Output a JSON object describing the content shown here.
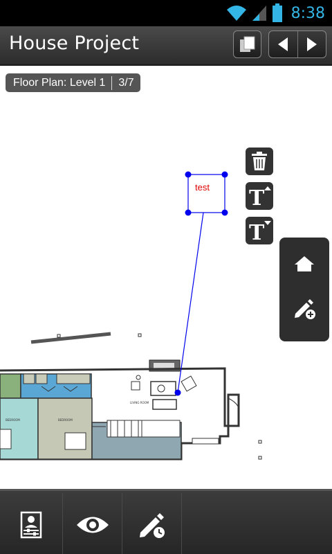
{
  "status_bar": {
    "time": "8:38",
    "icons": [
      "wifi-icon",
      "signal-icon",
      "battery-icon"
    ],
    "accent_color": "#33b5e5"
  },
  "action_bar": {
    "title": "House Project",
    "buttons": [
      "pages-icon",
      "previous-icon",
      "next-icon"
    ]
  },
  "plan": {
    "name": "Floor Plan: Level 1",
    "page": "3/7"
  },
  "annotation": {
    "text": "test",
    "text_color": "#e00000",
    "handle_color": "#0000ee"
  },
  "tools": [
    "delete-icon",
    "text-size-increase-icon",
    "text-size-decrease-icon"
  ],
  "side_panel": [
    "home-icon",
    "add-markup-icon"
  ],
  "bottom_bar": [
    "settings-icon",
    "view-icon",
    "markup-history-icon"
  ],
  "floor_plan_labels": [
    "LIVING ROOM",
    "BEDROOM",
    "BEDROOM"
  ]
}
